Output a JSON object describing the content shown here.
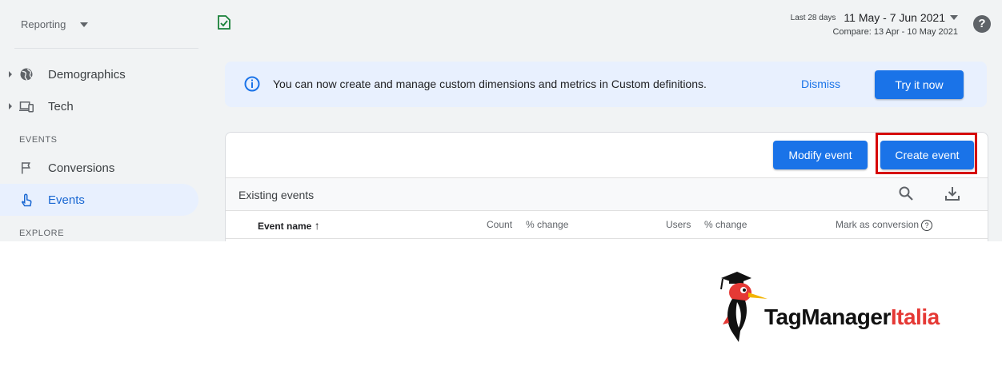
{
  "sidebar": {
    "property_menu": "Reporting",
    "items": [
      {
        "label": "Demographics",
        "icon": "globe-icon"
      },
      {
        "label": "Tech",
        "icon": "devices-icon"
      }
    ],
    "sections": [
      {
        "title": "EVENTS",
        "items": [
          {
            "label": "Conversions",
            "icon": "flag-icon"
          },
          {
            "label": "Events",
            "icon": "touch-icon",
            "active": true
          }
        ]
      },
      {
        "title": "EXPLORE"
      }
    ]
  },
  "header": {
    "period_label": "Last 28 days",
    "date_range": "11 May - 7 Jun 2021",
    "compare": "Compare: 13 Apr - 10 May 2021"
  },
  "banner": {
    "message": "You can now create and manage custom dimensions and metrics in Custom definitions.",
    "dismiss_label": "Dismiss",
    "try_label": "Try it now"
  },
  "events_card": {
    "modify_label": "Modify event",
    "create_label": "Create event",
    "section_title": "Existing events",
    "columns": [
      "Event name",
      "Count",
      "% change",
      "Users",
      "% change",
      "Mark as conversion"
    ],
    "sort_indicator": "↑",
    "help_glyph": "?"
  },
  "logo": {
    "brand_dark": "TagManager",
    "brand_red": "Italia"
  },
  "colors": {
    "accent": "#1a73e8",
    "highlight": "#d60000",
    "banner_bg": "#e8f0fe",
    "brand_red": "#e53935"
  }
}
